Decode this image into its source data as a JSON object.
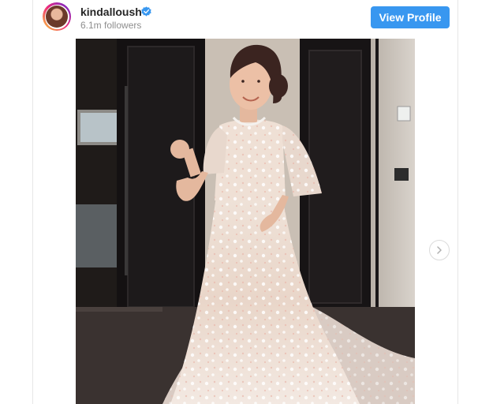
{
  "header": {
    "username": "kindalloush",
    "followers": "6.1m followers",
    "view_profile_label": "View Profile"
  },
  "icons": {
    "avatar": "profile-avatar",
    "verified": "verified-badge-icon",
    "next": "chevron-right-icon"
  },
  "colors": {
    "button": "#3897f0",
    "verified": "#3897f0",
    "username": "#262626",
    "muted": "#8e8e8e"
  }
}
